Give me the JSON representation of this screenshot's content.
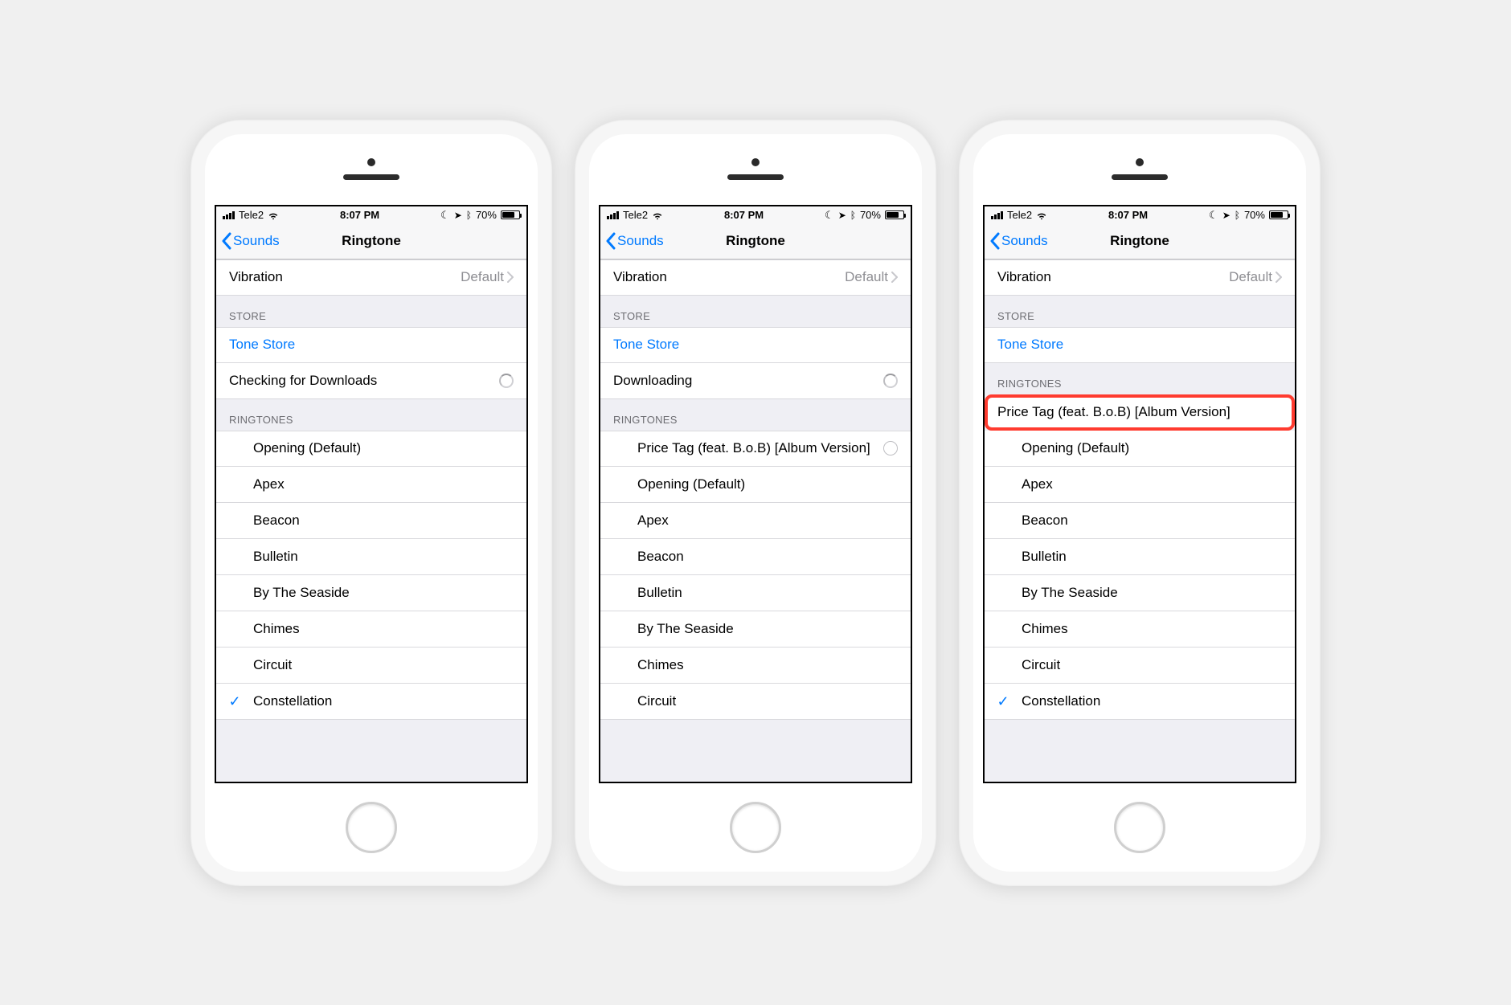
{
  "status": {
    "carrier": "Tele2",
    "time": "8:07 PM",
    "battery_text": "70%",
    "battery_fill_pct": 70
  },
  "nav": {
    "back_label": "Sounds",
    "title": "Ringtone"
  },
  "vibration": {
    "label": "Vibration",
    "value": "Default"
  },
  "sections": {
    "store_header": "STORE",
    "ringtones_header": "RINGTONES",
    "tone_store_label": "Tone Store"
  },
  "phones": {
    "p1": {
      "store_status": "Checking for Downloads",
      "ringtones": [
        {
          "label": "Opening (Default)"
        },
        {
          "label": "Apex"
        },
        {
          "label": "Beacon"
        },
        {
          "label": "Bulletin"
        },
        {
          "label": "By The Seaside"
        },
        {
          "label": "Chimes"
        },
        {
          "label": "Circuit"
        },
        {
          "label": "Constellation",
          "checked": true
        }
      ]
    },
    "p2": {
      "store_status": "Downloading",
      "ringtones": [
        {
          "label": "Price Tag (feat. B.o.B) [Album Version]",
          "downloading": true
        },
        {
          "label": "Opening (Default)"
        },
        {
          "label": "Apex"
        },
        {
          "label": "Beacon"
        },
        {
          "label": "Bulletin"
        },
        {
          "label": "By The Seaside"
        },
        {
          "label": "Chimes"
        },
        {
          "label": "Circuit"
        }
      ]
    },
    "p3": {
      "ringtones": [
        {
          "label": "Price Tag (feat. B.o.B) [Album Version]",
          "highlighted": true
        },
        {
          "label": "Opening (Default)"
        },
        {
          "label": "Apex"
        },
        {
          "label": "Beacon"
        },
        {
          "label": "Bulletin"
        },
        {
          "label": "By The Seaside"
        },
        {
          "label": "Chimes"
        },
        {
          "label": "Circuit"
        },
        {
          "label": "Constellation",
          "checked": true
        }
      ]
    }
  }
}
